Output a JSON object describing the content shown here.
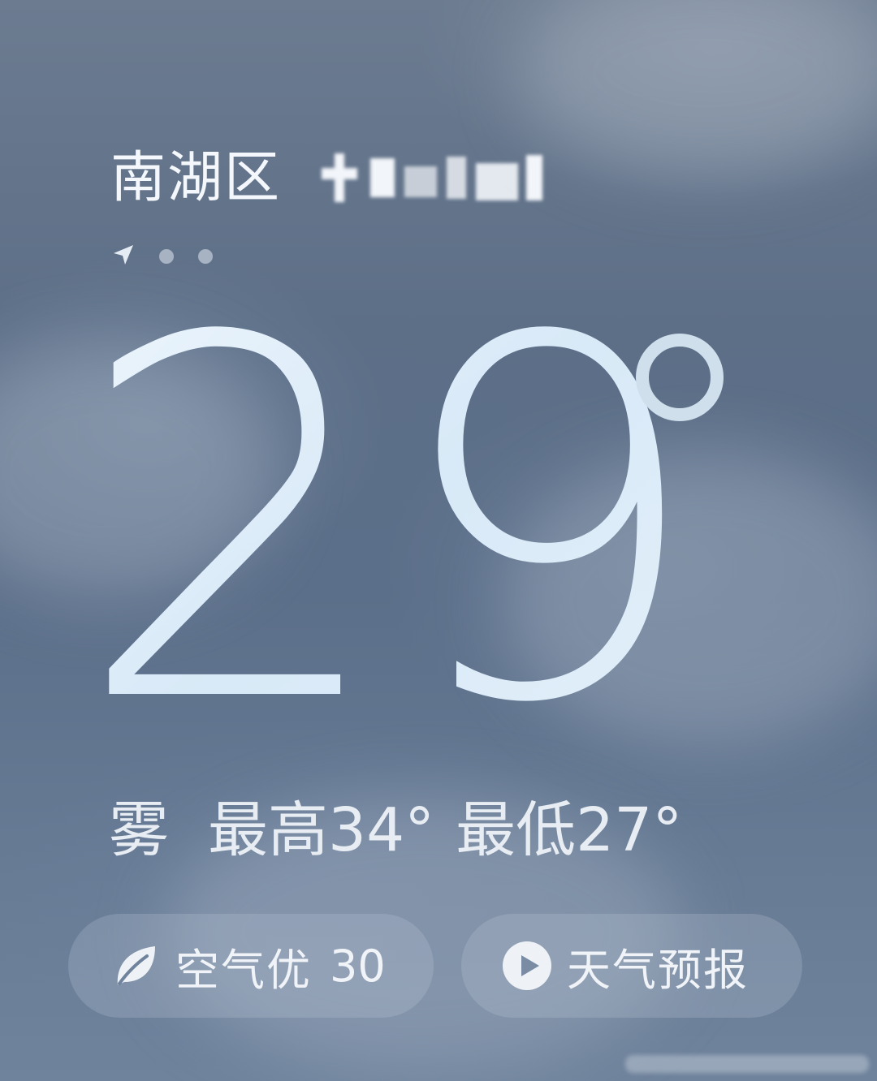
{
  "location": {
    "city": "南湖区",
    "detail_masked": true
  },
  "page_indicator": {
    "pages": 3,
    "current": 1,
    "first_is_location": true
  },
  "current": {
    "temperature": "29",
    "unit_symbol": "°"
  },
  "summary": {
    "condition": "雾",
    "high_label": "最高",
    "high_value": "34°",
    "low_label": "最低",
    "low_value": "27°"
  },
  "buttons": {
    "air": {
      "label": "空气优",
      "value": "30",
      "icon": "leaf-icon"
    },
    "forecast": {
      "label": "天气预报",
      "icon": "play-circle-icon"
    }
  },
  "colors": {
    "temperature": "#dcecf9",
    "text": "#eef2f7",
    "pill_bg": "rgba(200,210,222,0.22)"
  }
}
